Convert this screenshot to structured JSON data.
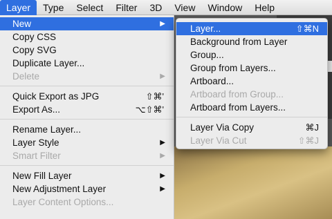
{
  "menubar": {
    "items": [
      {
        "label": "Layer",
        "active": true
      },
      {
        "label": "Type"
      },
      {
        "label": "Select"
      },
      {
        "label": "Filter"
      },
      {
        "label": "3D"
      },
      {
        "label": "View"
      },
      {
        "label": "Window"
      },
      {
        "label": "Help"
      }
    ]
  },
  "layer_menu": {
    "items": [
      {
        "label": "New",
        "submenu_arrow": "▶",
        "highlighted": true
      },
      {
        "label": "Copy CSS"
      },
      {
        "label": "Copy SVG"
      },
      {
        "label": "Duplicate Layer..."
      },
      {
        "label": "Delete",
        "submenu_arrow": "▶",
        "disabled": true
      },
      {
        "label": "Quick Export as JPG",
        "shortcut": "⇧⌘'"
      },
      {
        "label": "Export As...",
        "shortcut": "⌥⇧⌘'"
      },
      {
        "label": "Rename Layer..."
      },
      {
        "label": "Layer Style",
        "submenu_arrow": "▶"
      },
      {
        "label": "Smart Filter",
        "submenu_arrow": "▶",
        "disabled": true
      },
      {
        "label": "New Fill Layer",
        "submenu_arrow": "▶"
      },
      {
        "label": "New Adjustment Layer",
        "submenu_arrow": "▶"
      },
      {
        "label": "Layer Content Options...",
        "disabled": true
      }
    ]
  },
  "new_submenu": {
    "items": [
      {
        "label": "Layer...",
        "shortcut": "⇧⌘N",
        "highlighted": true
      },
      {
        "label": "Background from Layer"
      },
      {
        "label": "Group..."
      },
      {
        "label": "Group from Layers..."
      },
      {
        "label": "Artboard..."
      },
      {
        "label": "Artboard from Group...",
        "disabled": true
      },
      {
        "label": "Artboard from Layers..."
      },
      {
        "label": "Layer Via Copy",
        "shortcut": "⌘J"
      },
      {
        "label": "Layer Via Cut",
        "shortcut": "⇧⌘J",
        "disabled": true
      }
    ]
  },
  "colors": {
    "highlight": "#2f6fe0",
    "menu_bg": "#ececec",
    "disabled_text": "#a9a9a9"
  }
}
